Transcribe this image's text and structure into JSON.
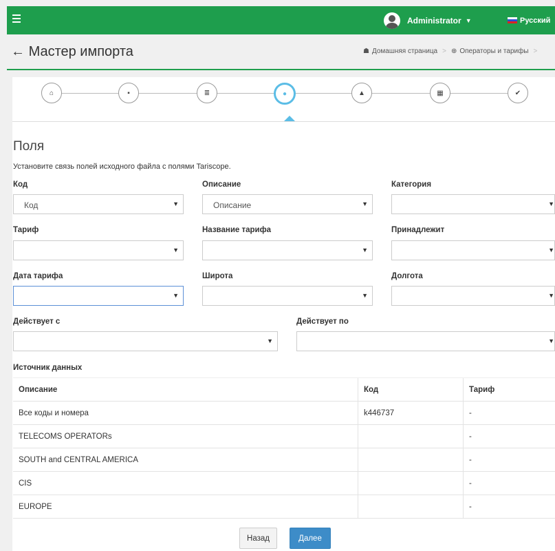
{
  "topbar": {
    "user": "Administrator",
    "language": "Русский"
  },
  "header": {
    "title": "Мастер импорта",
    "breadcrumb": [
      "Домашняя страница",
      "Операторы и тарифы"
    ]
  },
  "wizard": {
    "steps": [
      {
        "icon": "home-icon",
        "glyph": "⌂"
      },
      {
        "icon": "file-icon",
        "glyph": "▪"
      },
      {
        "icon": "list-icon",
        "glyph": "≣"
      },
      {
        "icon": "tag-icon",
        "glyph": "●"
      },
      {
        "icon": "lock-icon",
        "glyph": "▲"
      },
      {
        "icon": "calculator-icon",
        "glyph": "▦"
      },
      {
        "icon": "check-icon",
        "glyph": "✔"
      }
    ],
    "active_step": 4
  },
  "section": {
    "title": "Поля",
    "subtitle": "Установите связь полей исходного файла с полями Tariscope."
  },
  "fields": {
    "code": {
      "label": "Код",
      "value": "Код"
    },
    "description": {
      "label": "Описание",
      "value": "Описание"
    },
    "category": {
      "label": "Категория",
      "value": ""
    },
    "tariff": {
      "label": "Тариф",
      "value": ""
    },
    "tariff_name": {
      "label": "Название тарифа",
      "value": ""
    },
    "belongs": {
      "label": "Принадлежит",
      "value": ""
    },
    "tariff_date": {
      "label": "Дата тарифа",
      "value": ""
    },
    "latitude": {
      "label": "Широта",
      "value": ""
    },
    "longitude": {
      "label": "Долгота",
      "value": ""
    },
    "valid_from": {
      "label": "Действует с",
      "value": ""
    },
    "valid_to": {
      "label": "Действует по",
      "value": ""
    }
  },
  "data_source": {
    "label": "Источник данных",
    "columns": [
      "Описание",
      "Код",
      "Тариф"
    ],
    "rows": [
      [
        "Все коды и номера",
        "k446737",
        "-"
      ],
      [
        "TELECOMS OPERATORs",
        "",
        "-"
      ],
      [
        "SOUTH and CENTRAL AMERICA",
        "",
        "-"
      ],
      [
        "CIS",
        "",
        "-"
      ],
      [
        "EUROPE",
        "",
        "-"
      ]
    ]
  },
  "buttons": {
    "back": "Назад",
    "next": "Далее"
  },
  "colors": {
    "brand": "#1e9e4d",
    "active_step": "#5bbde6",
    "primary_button": "#3d8cc8"
  }
}
